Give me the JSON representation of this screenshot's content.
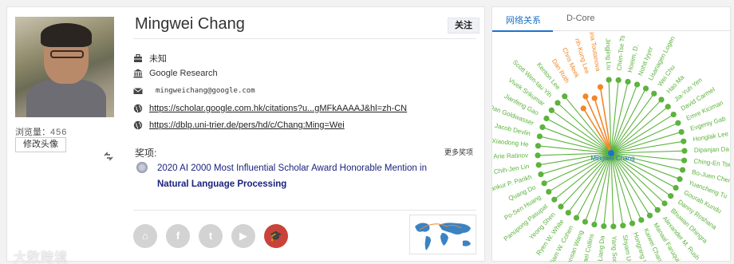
{
  "profile": {
    "name": "Mingwei Chang",
    "follow_label": "关注",
    "views_label": "浏览量：",
    "views_count": "456",
    "change_avatar_label": "修改头像",
    "position": "未知",
    "affiliation": "Google Research",
    "email": "mingweichang@google.com",
    "scholar_link": "https://scholar.google.com.hk/citations?u...gMFkAAAAJ&hl=zh-CN",
    "dblp_link": "https://dblp.uni-trier.de/pers/hd/c/Chang:Ming=Wei"
  },
  "awards": {
    "heading": "奖项:",
    "more_label": "更多奖项",
    "item_line1": "2020 AI 2000 Most Influential Scholar Award Honorable Mention in",
    "item_line2": "Natural Language Processing"
  },
  "socials": [
    {
      "name": "home",
      "glyph": "⌂"
    },
    {
      "name": "facebook",
      "glyph": "f"
    },
    {
      "name": "twitter",
      "glyph": "t"
    },
    {
      "name": "youtube",
      "glyph": "▶"
    },
    {
      "name": "scholar",
      "glyph": "🎓"
    }
  ],
  "watermark": "大数跨境",
  "network": {
    "tabs": [
      "网络关系",
      "D-Core"
    ],
    "center_label": "Mingwei Chang",
    "colors": {
      "green": "#5cb33d",
      "orange": "#f0872a",
      "center": "#1e73c8"
    },
    "nodes": [
      {
        "label": "Chen-Tse Ts",
        "hl": false
      },
      {
        "label": "Hoeim, D.",
        "hl": false
      },
      {
        "label": "Nohit Iyyer",
        "hl": false
      },
      {
        "label": "Lisanagen Logen",
        "hl": false
      },
      {
        "label": "Wei Chu",
        "hl": false
      },
      {
        "label": "Hao Ma",
        "hl": false
      },
      {
        "label": "Jia-Yuh Yen",
        "hl": false
      },
      {
        "label": "David Carmel",
        "hl": false
      },
      {
        "label": "Emre Kiciman",
        "hl": false
      },
      {
        "label": "Evgeniy Gab",
        "hl": false
      },
      {
        "label": "Honglak Lee",
        "hl": false
      },
      {
        "label": "Dipanjan Da",
        "hl": false
      },
      {
        "label": "Ching-En Tse",
        "hl": false
      },
      {
        "label": "Bo-Juen Chen",
        "hl": false
      },
      {
        "label": "Yuancheng Tu",
        "hl": false
      },
      {
        "label": "Gourab Kundu",
        "hl": false
      },
      {
        "label": "Danny Roshana",
        "hl": false
      },
      {
        "label": "Bhuwan Dhingra",
        "hl": false
      },
      {
        "label": "Alexander M. Rush",
        "hl": false
      },
      {
        "label": "Manaal Faruqui",
        "hl": false
      },
      {
        "label": "Kaiwei Chang",
        "hl": false
      },
      {
        "label": "Hongning Wa",
        "hl": false
      },
      {
        "label": "Shyam Upad",
        "hl": false
      },
      {
        "label": "Yang Song",
        "hl": false
      },
      {
        "label": "Yi-Liang Da",
        "hl": false
      },
      {
        "label": "Michael Collins",
        "hl": false
      },
      {
        "label": "Kuansan Wang",
        "hl": false
      },
      {
        "label": "William W. Cohen",
        "hl": false
      },
      {
        "label": "Ryen W. White",
        "hl": false
      },
      {
        "label": "Yeong Shen",
        "hl": false
      },
      {
        "label": "Panupong Pasupat",
        "hl": false
      },
      {
        "label": "Po-Sen Huang",
        "hl": false
      },
      {
        "label": "Quang Do",
        "hl": false
      },
      {
        "label": "ankur P. Parikh",
        "hl": false
      },
      {
        "label": "Chih-Jen Lin",
        "hl": false
      },
      {
        "label": "Arie Ratinov",
        "hl": false
      },
      {
        "label": "Xiaodong He",
        "hl": false
      },
      {
        "label": "Jacob Devlin",
        "hl": false
      },
      {
        "label": "Dan Goldwasser",
        "hl": false
      },
      {
        "label": "Jianfeng Gao",
        "hl": false
      },
      {
        "label": "Vivek Srikumar",
        "hl": false
      },
      {
        "label": "Scott Wen-tau Yih",
        "hl": false
      },
      {
        "label": "Kenton Lee",
        "hl": false
      },
      {
        "label": "Dan Roth",
        "hl": true
      },
      {
        "label": "Chris Meek",
        "hl": true
      },
      {
        "label": "nh-Kung Lee",
        "hl": true
      },
      {
        "label": "ristina Toutanova",
        "hl": true
      },
      {
        "label": "Jingjing Liu",
        "hl": false
      }
    ]
  }
}
